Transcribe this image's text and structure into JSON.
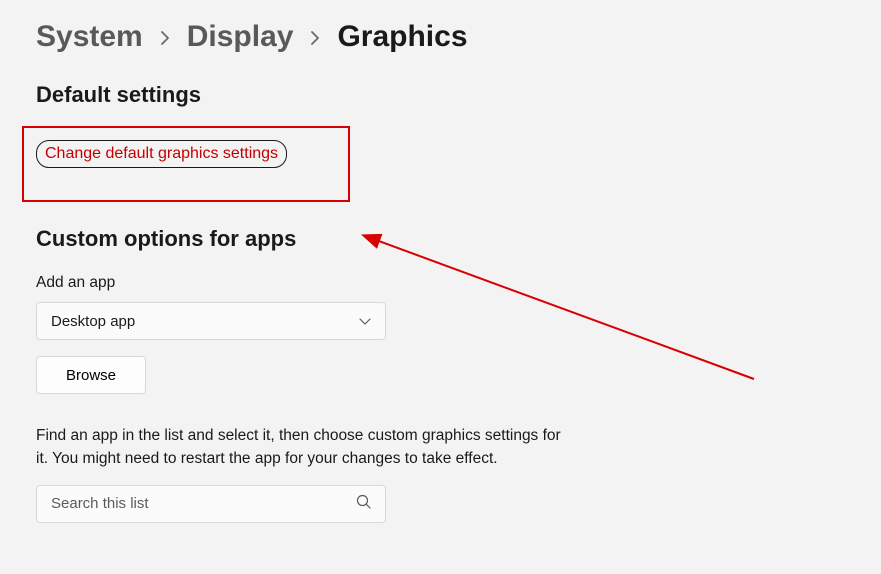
{
  "breadcrumb": {
    "items": [
      "System",
      "Display"
    ],
    "current": "Graphics"
  },
  "sections": {
    "default": {
      "title": "Default settings",
      "change_link": "Change default graphics settings"
    },
    "custom": {
      "title": "Custom options for apps",
      "add_label": "Add an app",
      "dropdown_value": "Desktop app",
      "browse_label": "Browse",
      "help_text": "Find an app in the list and select it, then choose custom graphics settings for it. You might need to restart the app for your changes to take effect.",
      "search_placeholder": "Search this list"
    }
  },
  "annotation": {
    "highlight_color": "#d80000"
  }
}
